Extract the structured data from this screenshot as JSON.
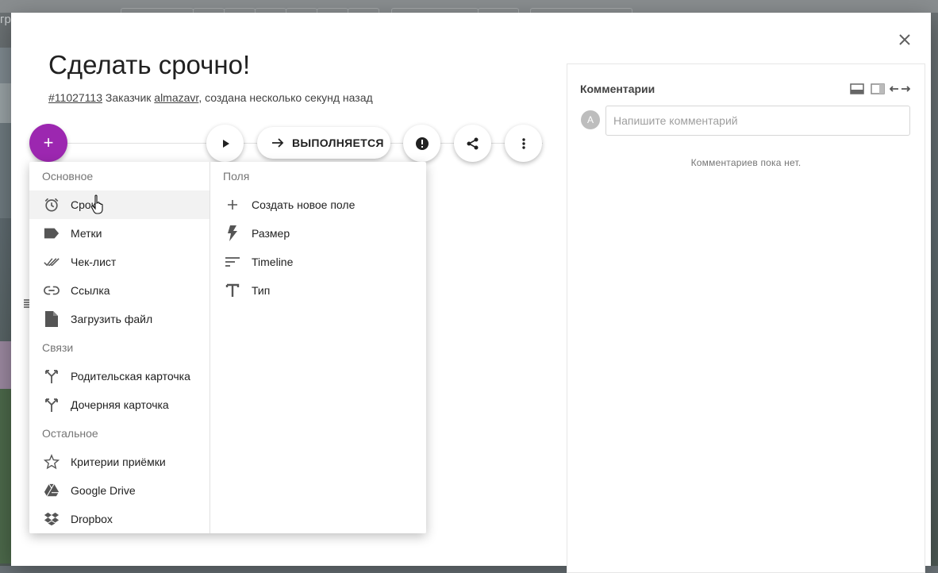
{
  "background": {
    "left_text": "гр"
  },
  "dialog": {
    "title": "Сделать срочно!",
    "meta": {
      "card_id": "#11027113",
      "customer_label": "Заказчик",
      "customer": "almazavr",
      "created": ", создана несколько секунд назад"
    },
    "close_icon": "close-icon"
  },
  "toolbar": {
    "add_label": "+",
    "status_label": "ВЫПОЛНЯЕТСЯ",
    "accent_color": "#9c27b0"
  },
  "add_menu": {
    "basic": {
      "heading": "Основное",
      "items": [
        {
          "label": "Срок",
          "icon": "alarm-clock-icon"
        },
        {
          "label": "Метки",
          "icon": "label-tag-icon"
        },
        {
          "label": "Чек-лист",
          "icon": "double-check-icon"
        },
        {
          "label": "Ссылка",
          "icon": "link-icon"
        },
        {
          "label": "Загрузить файл",
          "icon": "file-icon"
        }
      ]
    },
    "links": {
      "heading": "Связи",
      "items": [
        {
          "label": "Родительская карточка",
          "icon": "merge-icon"
        },
        {
          "label": "Дочерняя карточка",
          "icon": "merge-icon"
        }
      ]
    },
    "other": {
      "heading": "Остальное",
      "items": [
        {
          "label": "Критерии приёмки",
          "icon": "star-outline-icon"
        },
        {
          "label": "Google Drive",
          "icon": "google-drive-icon"
        },
        {
          "label": "Dropbox",
          "icon": "dropbox-icon"
        }
      ]
    },
    "fields": {
      "heading": "Поля",
      "items": [
        {
          "label": "Создать новое поле",
          "icon": "plus-icon"
        },
        {
          "label": "Размер",
          "icon": "lightning-icon"
        },
        {
          "label": "Timeline",
          "icon": "sort-lines-icon"
        },
        {
          "label": "Тип",
          "icon": "text-type-icon"
        }
      ]
    }
  },
  "comments": {
    "title": "Комментарии",
    "avatar_letter": "A",
    "placeholder": "Напишите комментарий",
    "empty_text": "Комментариев пока нет."
  }
}
